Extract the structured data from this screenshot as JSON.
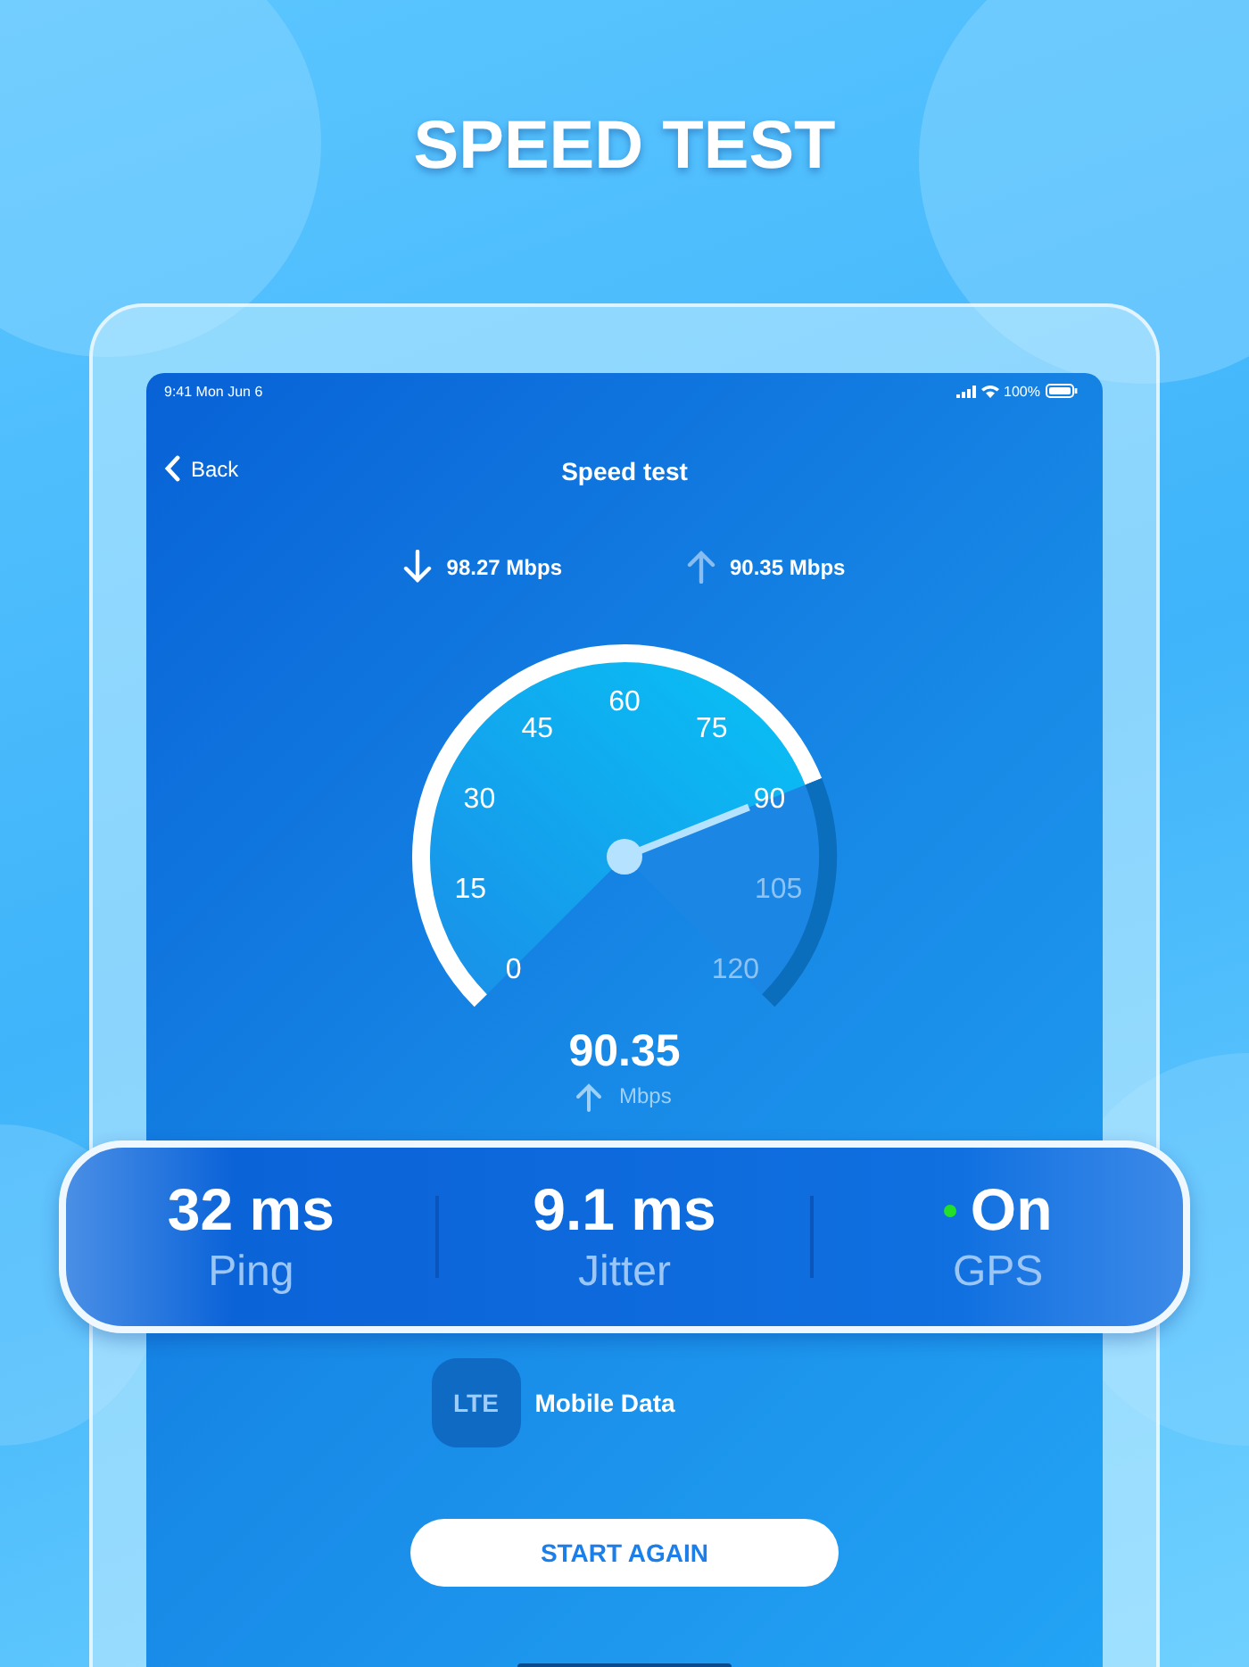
{
  "headline": "SPEED TEST",
  "status_bar": {
    "time": "9:41",
    "date": "Mon Jun 6",
    "battery": "100%"
  },
  "nav": {
    "back": "Back",
    "title": "Speed test"
  },
  "speeds": [
    {
      "kind": "download",
      "value": "98.27 Mbps"
    },
    {
      "kind": "upload",
      "value": "90.35 Mbps"
    }
  ],
  "gauge": {
    "ticks": [
      "0",
      "15",
      "30",
      "45",
      "60",
      "75",
      "90",
      "105",
      "120"
    ],
    "level": 0.753,
    "reading": "90.35",
    "unit": "Mbps"
  },
  "stats": [
    {
      "value": "32 ms",
      "label": "Ping",
      "dot": false
    },
    {
      "value": "9.1 ms",
      "label": "Jitter",
      "dot": false
    },
    {
      "value": "On",
      "label": "GPS",
      "dot": true
    }
  ],
  "network": {
    "badge": "LTE",
    "label": "Mobile Data"
  },
  "button": "START AGAIN"
}
